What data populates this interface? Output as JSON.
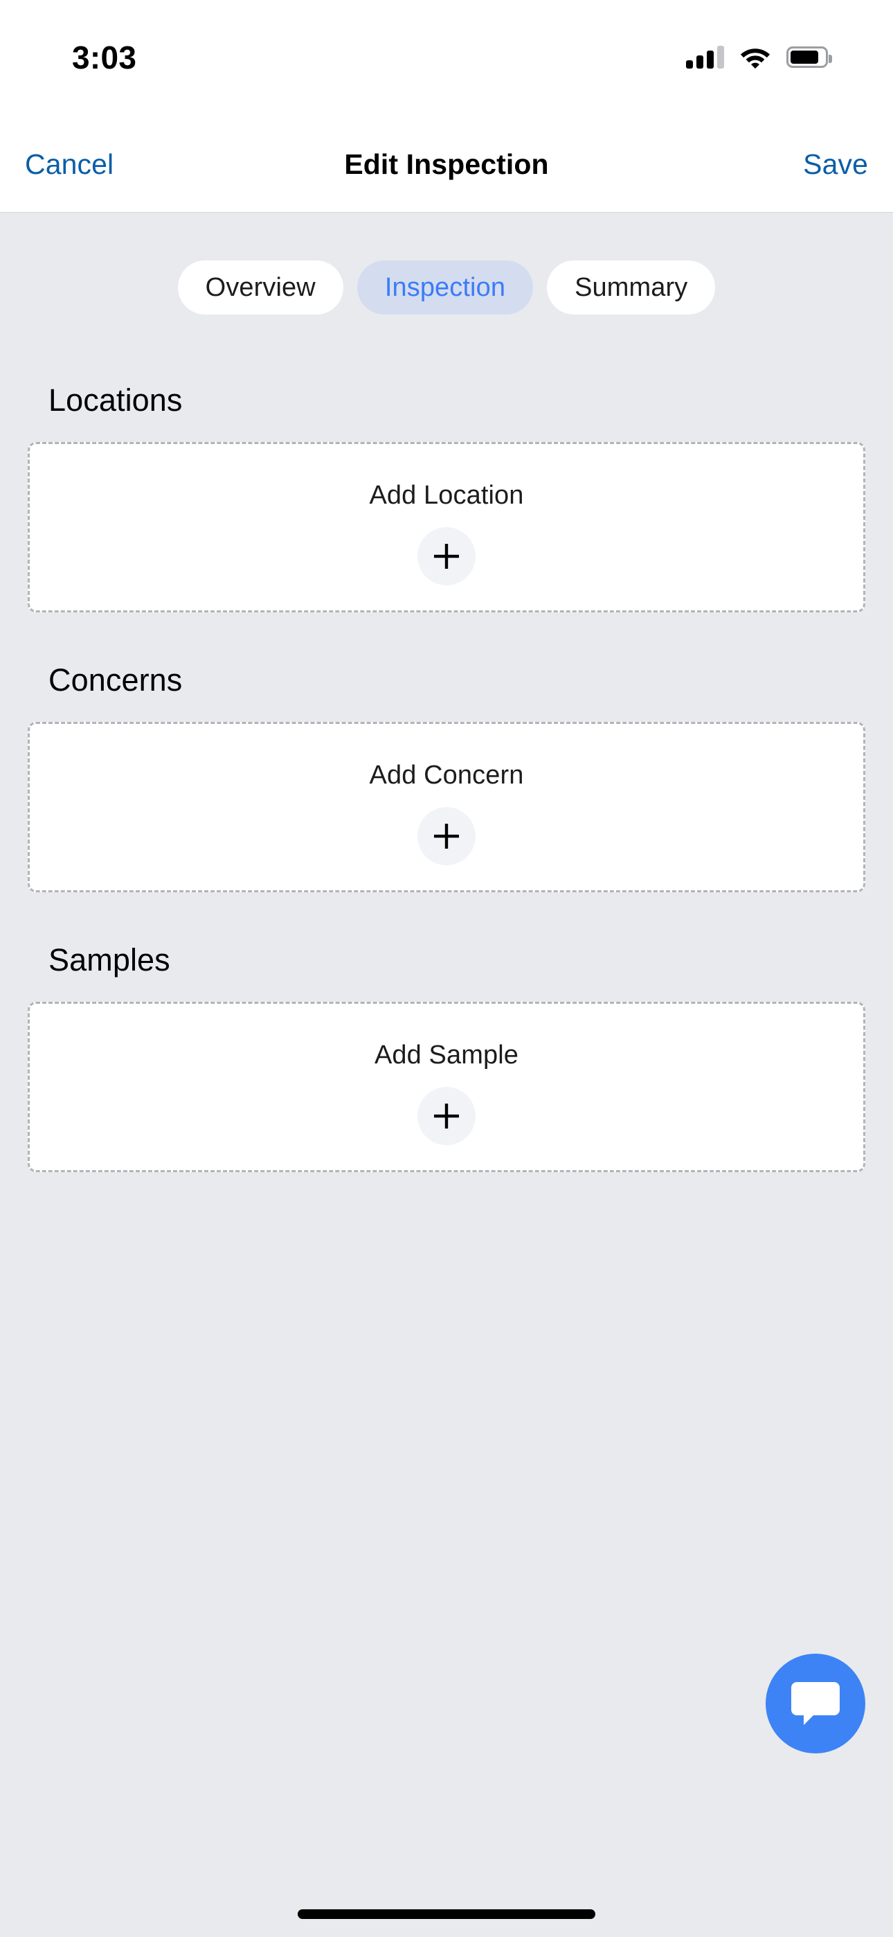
{
  "status_bar": {
    "time": "3:03",
    "signal_icon": "cellular-signal-icon",
    "signal_bars_filled": 3,
    "signal_bars_total": 4,
    "wifi_icon": "wifi-icon",
    "battery_icon": "battery-icon",
    "battery_level_percent": 84
  },
  "nav_bar": {
    "cancel_label": "Cancel",
    "title": "Edit Inspection",
    "save_label": "Save",
    "link_color": "#0a5ea8"
  },
  "segmented_control": {
    "tabs": [
      {
        "label": "Overview",
        "active": false
      },
      {
        "label": "Inspection",
        "active": true
      },
      {
        "label": "Summary",
        "active": false
      }
    ],
    "active_bg": "#d4dcf0",
    "active_text": "#3b7cf6"
  },
  "sections": [
    {
      "title": "Locations",
      "add_label": "Add Location",
      "add_icon": "plus-icon"
    },
    {
      "title": "Concerns",
      "add_label": "Add Concern",
      "add_icon": "plus-icon"
    },
    {
      "title": "Samples",
      "add_label": "Add Sample",
      "add_icon": "plus-icon"
    }
  ],
  "floating_action": {
    "icon": "chat-bubble-icon",
    "color": "#3d83f5"
  },
  "colors": {
    "page_background": "#e8eaed",
    "card_background": "#ffffff",
    "card_border": "#b2b4b7"
  }
}
